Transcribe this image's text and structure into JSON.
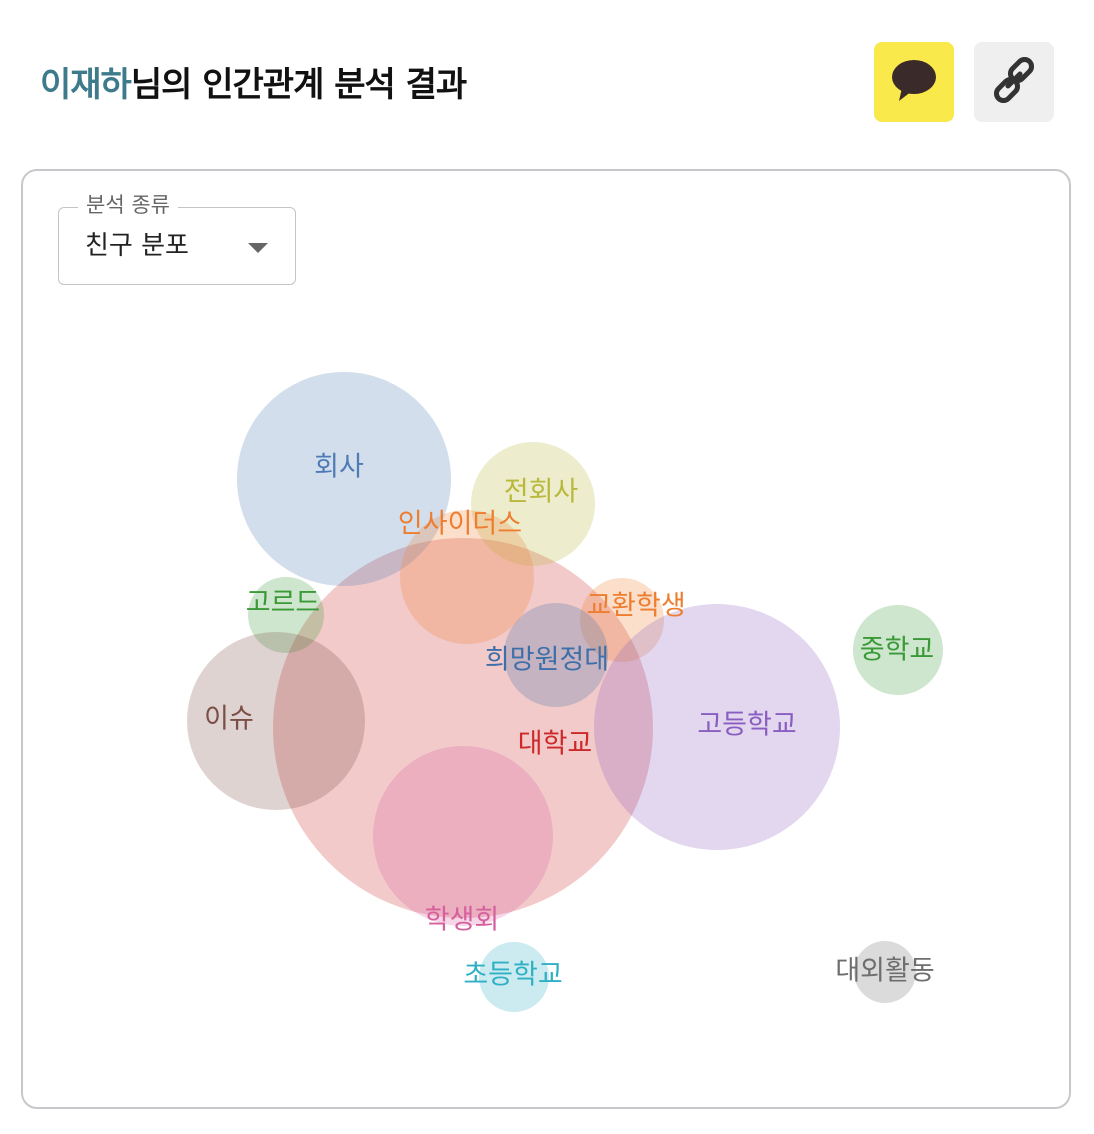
{
  "header": {
    "user_name": "이재하",
    "title_suffix": "님의 인간관계 분석 결과"
  },
  "buttons": {
    "share_kakao_icon": "speech-bubble-icon",
    "copy_link_icon": "link-icon",
    "kakao_color": "#fae94a"
  },
  "analysis_select": {
    "legend": "분석 종류",
    "value": "친구 분포"
  },
  "chart_data": {
    "type": "bubble",
    "title": "",
    "series": [
      {
        "name": "회사",
        "color": "#4f7bb5"
      },
      {
        "name": "전회사",
        "color": "#b8b83a"
      },
      {
        "name": "인사이더스",
        "color": "#ee7e2f"
      },
      {
        "name": "고르드",
        "color": "#3a9a37"
      },
      {
        "name": "교환학생",
        "color": "#ee7e2f"
      },
      {
        "name": "희망원정대",
        "color": "#3e6fa8"
      },
      {
        "name": "중학교",
        "color": "#3a9a37"
      },
      {
        "name": "이슈",
        "color": "#7b4e47"
      },
      {
        "name": "대학교",
        "color": "#cc2a2a"
      },
      {
        "name": "고등학교",
        "color": "#8a5ec0"
      },
      {
        "name": "학생회",
        "color": "#d6609e"
      },
      {
        "name": "초등학교",
        "color": "#2fb0c4"
      },
      {
        "name": "대외활동",
        "color": "#6e6e6e"
      }
    ]
  }
}
